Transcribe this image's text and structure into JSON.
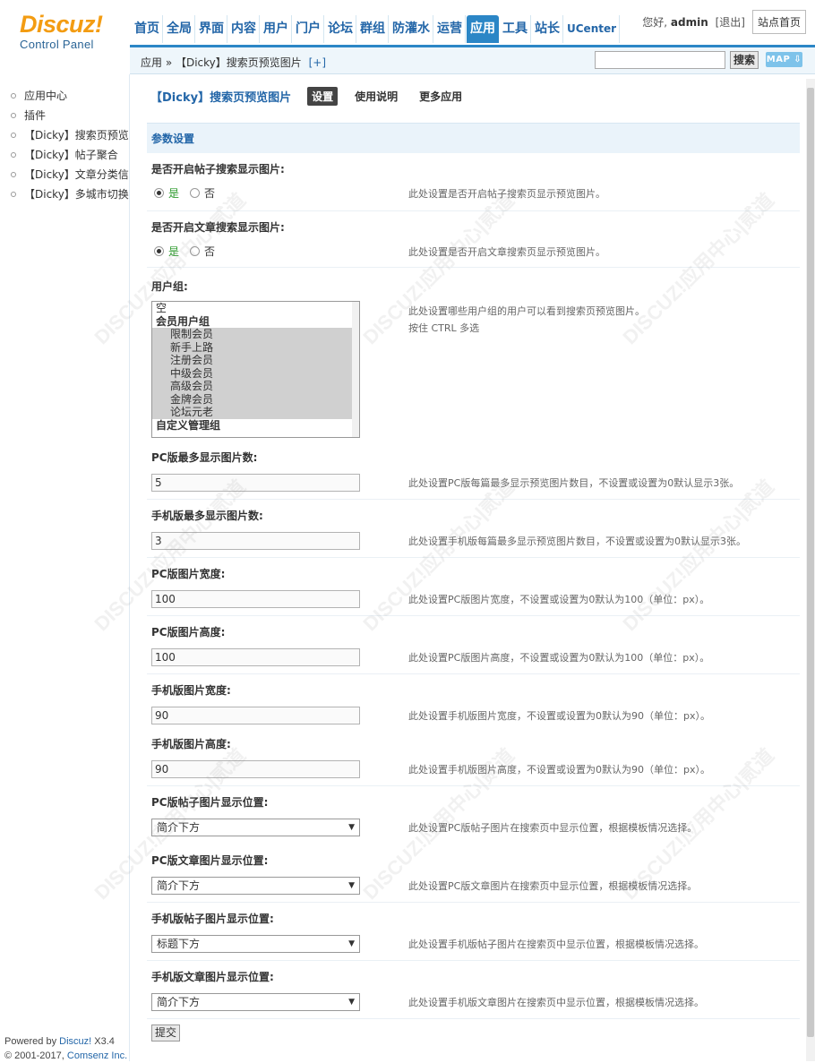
{
  "brand": {
    "name": "Discuz!",
    "subtitle": "Control Panel"
  },
  "nav": [
    "首页",
    "全局",
    "界面",
    "内容",
    "用户",
    "门户",
    "论坛",
    "群组",
    "防灌水",
    "运营",
    "应用",
    "工具",
    "站长",
    "UCenter"
  ],
  "user": {
    "greeting": "您好,",
    "name": "admin",
    "logout": "[退出]",
    "site_home": "站点首页"
  },
  "breadcrumb": {
    "text": "应用 » 【Dicky】搜索页预览图片",
    "add": "[+]"
  },
  "search": {
    "button": "搜索",
    "map": "MAP ⇩"
  },
  "sidebar": {
    "items": [
      "应用中心",
      "插件",
      "【Dicky】搜索页预览图片",
      "【Dicky】帖子聚合",
      "【Dicky】文章分类信息",
      "【Dicky】多城市切换(分站)"
    ],
    "footer_powered": "Powered by",
    "footer_brand": "Discuz!",
    "footer_version": "X3.4",
    "footer_copy": "© 2001-2017,",
    "footer_company": "Comsenz Inc."
  },
  "page": {
    "title": "【Dicky】搜索页预览图片",
    "tabs": [
      "设置",
      "使用说明",
      "更多应用"
    ],
    "section": "参数设置"
  },
  "settings": {
    "thread_img": {
      "label": "是否开启帖子搜索显示图片:",
      "yes": "是",
      "no": "否",
      "desc": "此处设置是否开启帖子搜索页显示预览图片。"
    },
    "article_img": {
      "label": "是否开启文章搜索显示图片:",
      "yes": "是",
      "no": "否",
      "desc": "此处设置是否开启文章搜索页显示预览图片。"
    },
    "usergroup": {
      "label": "用户组:",
      "desc1": "此处设置哪些用户组的用户可以看到搜索页预览图片。",
      "desc2": "按住 CTRL 多选",
      "options": [
        "空",
        "会员用户组",
        "限制会员",
        "新手上路",
        "注册会员",
        "中级会员",
        "高级会员",
        "金牌会员",
        "论坛元老",
        "自定义管理组"
      ]
    },
    "pc_max": {
      "label": "PC版最多显示图片数:",
      "value": "5",
      "desc": "此处设置PC版每篇最多显示预览图片数目，不设置或设置为0默认显示3张。"
    },
    "mobile_max": {
      "label": "手机版最多显示图片数:",
      "value": "3",
      "desc": "此处设置手机版每篇最多显示预览图片数目，不设置或设置为0默认显示3张。"
    },
    "pc_width": {
      "label": "PC版图片宽度:",
      "value": "100",
      "desc": "此处设置PC版图片宽度，不设置或设置为0默认为100（单位：px）。"
    },
    "pc_height": {
      "label": "PC版图片高度:",
      "value": "100",
      "desc": "此处设置PC版图片高度，不设置或设置为0默认为100（单位：px）。"
    },
    "mobile_width": {
      "label": "手机版图片宽度:",
      "value": "90",
      "desc": "此处设置手机版图片宽度，不设置或设置为0默认为90（单位：px）。"
    },
    "mobile_height": {
      "label": "手机版图片高度:",
      "value": "90",
      "desc": "此处设置手机版图片高度，不设置或设置为0默认为90（单位：px）。"
    },
    "pc_thread_pos": {
      "label": "PC版帖子图片显示位置:",
      "value": "简介下方",
      "desc": "此处设置PC版帖子图片在搜索页中显示位置，根据模板情况选择。"
    },
    "pc_article_pos": {
      "label": "PC版文章图片显示位置:",
      "value": "简介下方",
      "desc": "此处设置PC版文章图片在搜索页中显示位置，根据模板情况选择。"
    },
    "mobile_thread_pos": {
      "label": "手机版帖子图片显示位置:",
      "value": "标题下方",
      "desc": "此处设置手机版帖子图片在搜索页中显示位置，根据模板情况选择。"
    },
    "mobile_article_pos": {
      "label": "手机版文章图片显示位置:",
      "value": "简介下方",
      "desc": "此处设置手机版文章图片在搜索页中显示位置，根据模板情况选择。"
    }
  },
  "submit": "提交",
  "watermark": "DISCUZ!应用中心|贰道"
}
